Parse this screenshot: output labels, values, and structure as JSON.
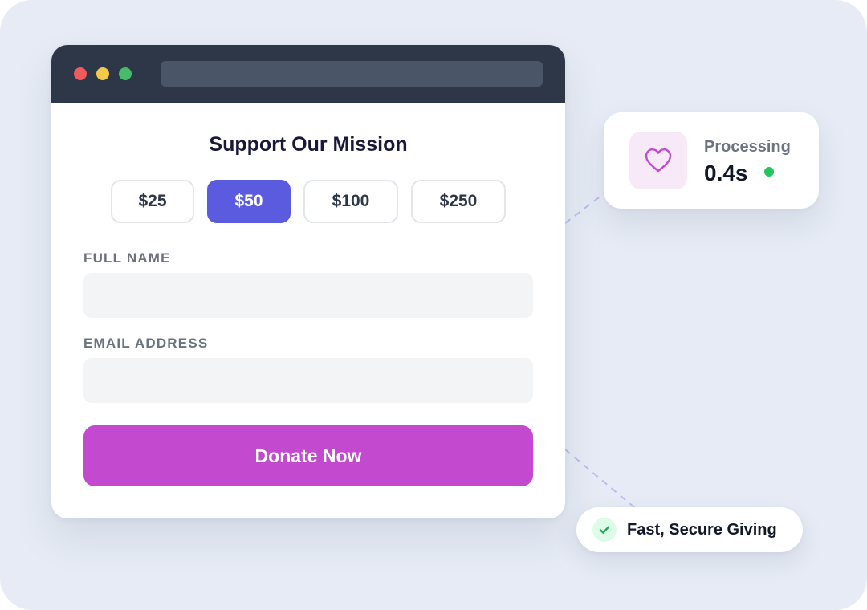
{
  "form": {
    "title": "Support Our Mission",
    "amounts": [
      "$25",
      "$50",
      "$100",
      "$250"
    ],
    "selected_amount": "$50",
    "full_name": {
      "label": "FULL NAME",
      "value": "",
      "placeholder": ""
    },
    "email": {
      "label": "EMAIL ADDRESS",
      "value": "",
      "placeholder": ""
    },
    "submit_label": "Donate Now"
  },
  "processing_card": {
    "icon": "heart-icon",
    "label": "Processing",
    "value": "0.4s",
    "status": "online"
  },
  "secure_badge": {
    "icon": "check-icon",
    "label": "Fast, Secure Giving"
  },
  "colors": {
    "accent_selected": "#5b5be0",
    "donate_button": "#c34acf",
    "status_green": "#22c55e",
    "titlebar": "#2d3748"
  }
}
